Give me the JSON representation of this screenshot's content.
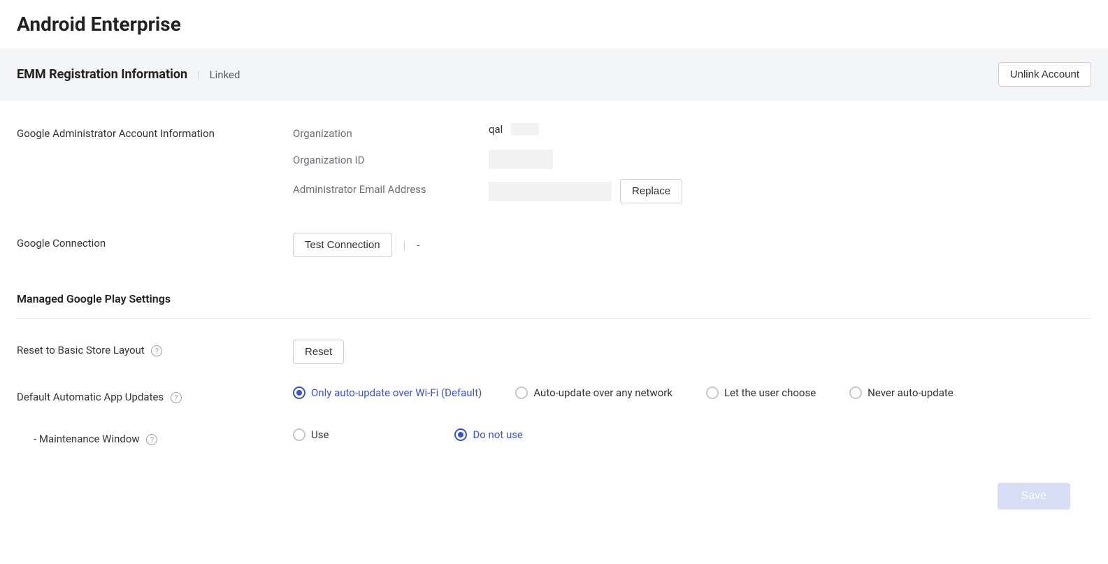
{
  "page": {
    "title": "Android Enterprise"
  },
  "header": {
    "title": "EMM Registration Information",
    "status": "Linked",
    "unlink_label": "Unlink Account"
  },
  "admin_info": {
    "section_label": "Google Administrator Account Information",
    "organization_label": "Organization",
    "organization_value": "qal",
    "org_id_label": "Organization ID",
    "org_id_value": "",
    "admin_email_label": "Administrator Email Address",
    "admin_email_value": "",
    "replace_label": "Replace"
  },
  "connection": {
    "section_label": "Google Connection",
    "test_label": "Test Connection",
    "result_text": "-"
  },
  "play_settings": {
    "heading": "Managed Google Play Settings",
    "reset_label": "Reset to Basic Store Layout",
    "reset_button": "Reset",
    "auto_update_label": "Default Automatic App Updates",
    "auto_update_options": {
      "wifi": "Only auto-update over Wi-Fi (Default)",
      "any": "Auto-update over any network",
      "user": "Let the user choose",
      "never": "Never auto-update"
    },
    "auto_update_selected": "wifi",
    "maintenance_label": "- Maintenance Window",
    "maintenance_options": {
      "use": "Use",
      "not_use": "Do not use"
    },
    "maintenance_selected": "not_use"
  },
  "footer": {
    "save_label": "Save"
  }
}
